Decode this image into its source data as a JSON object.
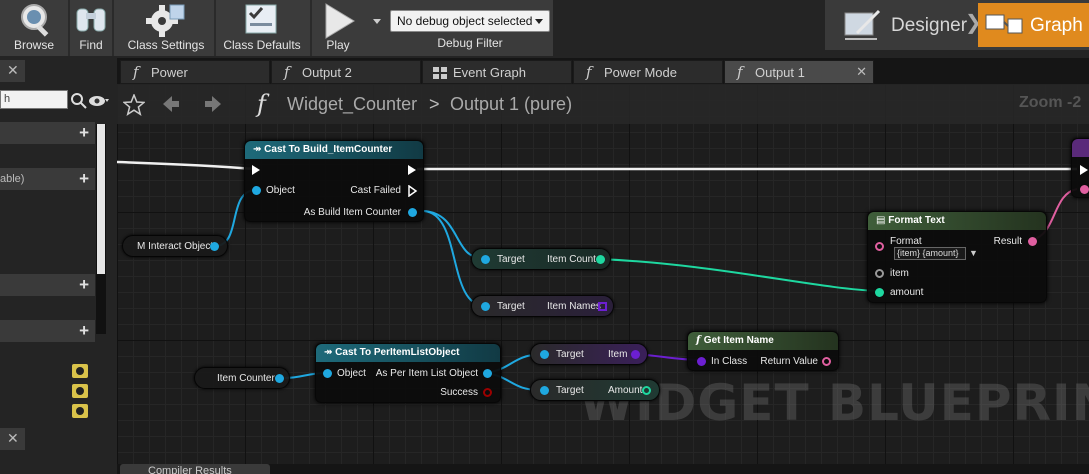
{
  "toolbar": {
    "browse_label": "Browse",
    "find_label": "Find",
    "class_settings_label": "Class Settings",
    "class_defaults_label": "Class Defaults",
    "play_label": "Play",
    "debug_object_value": "No debug object selected",
    "debug_filter_label": "Debug Filter"
  },
  "mode_switch": {
    "designer_label": "Designer",
    "graph_label": "Graph",
    "active": "Graph",
    "accent_color": "#e08a1e"
  },
  "left_panel": {
    "search_placeholder": "h",
    "partial_text": "able)",
    "section_count": 4
  },
  "document_tabs": [
    {
      "label": "Power",
      "icon": "function-icon",
      "active": false
    },
    {
      "label": "Output 2",
      "icon": "function-icon",
      "active": false
    },
    {
      "label": "Event Graph",
      "icon": "event-graph-icon",
      "active": false
    },
    {
      "label": "Power Mode",
      "icon": "function-icon",
      "active": false
    },
    {
      "label": "Output 1",
      "icon": "function-icon",
      "active": true
    }
  ],
  "graph": {
    "breadcrumb_root": "Widget_Counter",
    "breadcrumb_separator": ">",
    "breadcrumb_leaf": "Output 1 (pure)",
    "zoom_label": "Zoom -2",
    "watermark": "WIDGET BLUEPRINT",
    "nodes": {
      "cast_build": {
        "title": "Cast To Build_ItemCounter",
        "object_pin": "Object",
        "cast_failed_pin": "Cast Failed",
        "as_pin": "As Build Item Counter"
      },
      "m_interact": {
        "label": "M Interact Object"
      },
      "get_item_count": {
        "target": "Target",
        "out": "Item Count"
      },
      "get_item_names": {
        "target": "Target",
        "out": "Item Names"
      },
      "format_text": {
        "title": "Format Text",
        "format_pin": "Format",
        "format_value": "{item} {amount}",
        "result_pin": "Result",
        "item_pin": "item",
        "amount_pin": "amount"
      },
      "item_counter": {
        "label": "Item Counter"
      },
      "cast_per_item": {
        "title": "Cast To PerItemListObject",
        "object_pin": "Object",
        "as_pin": "As Per Item List Object",
        "success_pin": "Success"
      },
      "get_item": {
        "target": "Target",
        "out": "Item"
      },
      "get_amount": {
        "target": "Target",
        "out": "Amount"
      },
      "get_item_name": {
        "title": "Get Item Name",
        "in_pin": "In Class",
        "out_pin": "Return Value"
      },
      "return_partial": {
        "title": ""
      }
    },
    "colors": {
      "object_pin": "#1fa8e0",
      "int_pin": "#1ed8a0",
      "class_pin": "#6c1fd1",
      "text_pin": "#e05fa0",
      "exec": "#ffffff",
      "bool_pin": "#9c0000"
    }
  },
  "bottom_tab": {
    "label": "Compiler Results"
  }
}
